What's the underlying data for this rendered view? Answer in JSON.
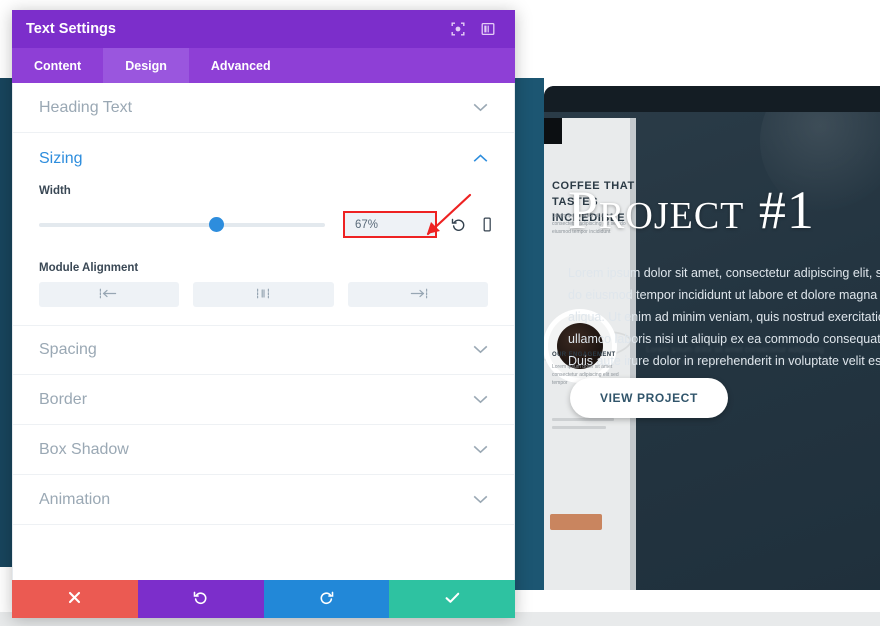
{
  "modal": {
    "title": "Text Settings",
    "header_icons": [
      {
        "name": "focus-target-icon"
      },
      {
        "name": "layout-panel-icon"
      }
    ],
    "tabs": [
      {
        "label": "Content",
        "active": false
      },
      {
        "label": "Design",
        "active": true
      },
      {
        "label": "Advanced",
        "active": false
      }
    ],
    "sections": {
      "heading_text": "Heading Text",
      "sizing": "Sizing",
      "spacing": "Spacing",
      "border": "Border",
      "box_shadow": "Box Shadow",
      "animation": "Animation"
    },
    "sizing": {
      "width_label": "Width",
      "width_value": "67%",
      "slider_percent": 62,
      "reset_icon": "undo-arrow-icon",
      "responsive_icon": "mobile-device-icon",
      "module_alignment_label": "Module Alignment",
      "alignment_options": [
        {
          "name": "align-left",
          "icon": "align-left-icon"
        },
        {
          "name": "align-center",
          "icon": "align-center-icon"
        },
        {
          "name": "align-right",
          "icon": "align-right-icon"
        }
      ]
    },
    "footer_buttons": [
      {
        "name": "close-button",
        "icon": "close-x-icon",
        "color": "#eb5a52"
      },
      {
        "name": "undo-button",
        "icon": "undo-arrow-icon",
        "color": "#7c2ecb"
      },
      {
        "name": "redo-button",
        "icon": "redo-arrow-icon",
        "color": "#2288d8"
      },
      {
        "name": "save-button",
        "icon": "checkmark-icon",
        "color": "#2ec2a1"
      }
    ]
  },
  "annotation": {
    "arrow_color": "#ee2222",
    "highlight_color": "#ee2222"
  },
  "preview": {
    "heading": "Project #1",
    "paragraph": "Lorem ipsum dolor sit amet, consectetur adipiscing elit, sed do eiusmod tempor incididunt ut labore et dolore magna aliqua. Ut enim ad minim veniam, quis nostrud exercitation ullamco laboris nisi ut aliquip ex ea commodo consequat. Duis aute irure dolor in reprehenderit in voluptate velit esse cillum dolore eu fugiat nulla pariatur. Excepteur sint occaecat cupidatat non proident, sunt in culpa qui officia deserunt mollit anim id est laborum.",
    "button_label": "VIEW PROJECT",
    "side_heading_line1": "COFFEE THAT TASTES",
    "side_heading_line2": "INCREDIBLE",
    "side_sub": "Lorem ipsum dolor sit amet consectetur adipiscing elit sed do eiusmod tempor incididunt",
    "side_heading2": "OUR ENGAGEMENT",
    "side_sub2": "Lorem ipsum dolor sit amet consectetur adipiscing elit sed tempor"
  }
}
